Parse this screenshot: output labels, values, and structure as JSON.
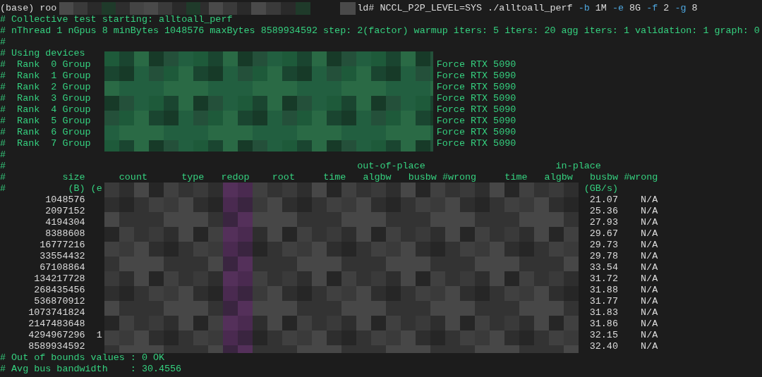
{
  "prompt": {
    "user": "(base) roo",
    "host_end": "ld#",
    "command": [
      {
        "text": "NCCL_P2P_LEVEL=SYS ./alltoall_perf",
        "kind": "arg"
      },
      {
        "text": "-b",
        "kind": "flag"
      },
      {
        "text": "1M",
        "kind": "arg"
      },
      {
        "text": "-e",
        "kind": "flag"
      },
      {
        "text": "8G",
        "kind": "arg"
      },
      {
        "text": "-f",
        "kind": "flag"
      },
      {
        "text": "2",
        "kind": "arg"
      },
      {
        "text": "-g",
        "kind": "flag"
      },
      {
        "text": "8",
        "kind": "arg"
      }
    ]
  },
  "info_lines": [
    "# Collective test starting: alltoall_perf",
    "# nThread 1 nGpus 8 minBytes 1048576 maxBytes 8589934592 step: 2(factor) warmup iters: 5 iters: 20 agg iters: 1 validation: 1 graph: 0",
    "#",
    "# Using devices"
  ],
  "devices": [
    {
      "label": "#  Rank  0 Group",
      "device": "Force RTX 5090"
    },
    {
      "label": "#  Rank  1 Group",
      "device": "Force RTX 5090"
    },
    {
      "label": "#  Rank  2 Group",
      "device": "Force RTX 5090"
    },
    {
      "label": "#  Rank  3 Group",
      "device": "Force RTX 5090"
    },
    {
      "label": "#  Rank  4 Group",
      "device": "Force RTX 5090"
    },
    {
      "label": "#  Rank  5 Group",
      "device": "Force RTX 5090"
    },
    {
      "label": "#  Rank  6 Group",
      "device": "Force RTX 5090"
    },
    {
      "label": "#  Rank  7 Group",
      "device": "Force RTX 5090"
    }
  ],
  "table": {
    "comment": "#",
    "group_headers": [
      "out-of-place",
      "in-place"
    ],
    "columns": [
      "size",
      "count",
      "type",
      "redop",
      "root",
      "time",
      "algbw",
      "busbw",
      "#wrong",
      "time",
      "algbw",
      "busbw",
      "#wrong"
    ],
    "units": [
      "(B)",
      "(e",
      "(GB/s)"
    ],
    "rows": [
      {
        "size": "1048576",
        "busbw": "21.07",
        "wrong": "N/A"
      },
      {
        "size": "2097152",
        "busbw": "25.36",
        "wrong": "N/A"
      },
      {
        "size": "4194304",
        "busbw": "27.93",
        "wrong": "N/A"
      },
      {
        "size": "8388608",
        "busbw": "29.67",
        "wrong": "N/A"
      },
      {
        "size": "16777216",
        "busbw": "29.73",
        "wrong": "N/A"
      },
      {
        "size": "33554432",
        "busbw": "29.78",
        "wrong": "N/A"
      },
      {
        "size": "67108864",
        "busbw": "33.54",
        "wrong": "N/A"
      },
      {
        "size": "134217728",
        "busbw": "31.72",
        "wrong": "N/A"
      },
      {
        "size": "268435456",
        "busbw": "31.88",
        "wrong": "N/A"
      },
      {
        "size": "536870912",
        "busbw": "31.77",
        "wrong": "N/A"
      },
      {
        "size": "1073741824",
        "busbw": "31.83",
        "wrong": "N/A"
      },
      {
        "size": "2147483648",
        "busbw": "31.86",
        "wrong": "N/A"
      },
      {
        "size": "4294967296",
        "count": "1",
        "busbw": "32.15",
        "wrong": "N/A"
      },
      {
        "size": "8589934592",
        "busbw": "32.40",
        "wrong": "N/A"
      }
    ]
  },
  "footer": [
    "# Out of bounds values : 0 OK",
    "# Avg bus bandwidth    : 30.4556"
  ]
}
